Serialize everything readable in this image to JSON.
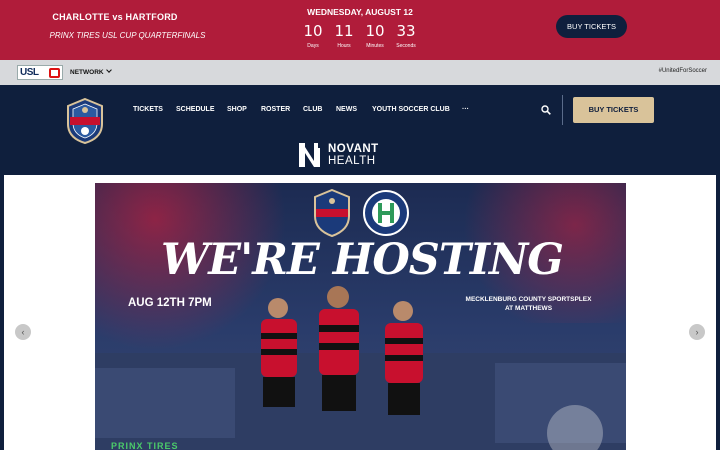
{
  "promo": {
    "match": "CHARLOTTE vs HARTFORD",
    "competition": "PRINX TIRES USL CUP QUARTERFINALS",
    "date": "WEDNESDAY, AUGUST 12",
    "countdown": [
      {
        "value": "10",
        "label": "Days"
      },
      {
        "value": "11",
        "label": "Hours"
      },
      {
        "value": "10",
        "label": "Minutes"
      },
      {
        "value": "33",
        "label": "Seconds"
      }
    ],
    "buy_label": "BUY TICKETS"
  },
  "usl_bar": {
    "logo_text": "USL",
    "network_label": "NETWORK",
    "hashtag": "#UnitedForSoccer"
  },
  "nav": {
    "items": [
      "TICKETS",
      "SCHEDULE",
      "SHOP",
      "ROSTER",
      "CLUB",
      "NEWS",
      "YOUTH SOCCER CLUB",
      "···"
    ],
    "buy_label": "BUY TICKETS",
    "sponsor_line1": "NOVANT",
    "sponsor_line2": "HEALTH"
  },
  "slide": {
    "headline": "WE'RE HOSTING",
    "when": "AUG 12TH 7PM",
    "venue_line1": "MECKLENBURG COUNTY SPORTSPLEX",
    "venue_line2": "AT MATTHEWS",
    "sponsor": "PRINX TIRES",
    "badge_home": "INDEPENDENCE",
    "badge_away": "HARTFORD ATHLETIC",
    "arrow_left": "‹",
    "arrow_right": "›"
  },
  "colors": {
    "promo_bg": "#b01c3a",
    "navy": "#0f1f3d",
    "gold": "#d9c39a",
    "red": "#c8102e"
  }
}
